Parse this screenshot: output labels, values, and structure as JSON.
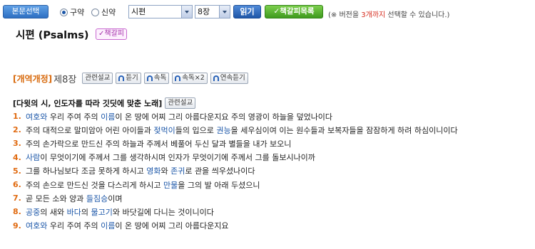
{
  "toolbar": {
    "select_label": "본문선택",
    "radio_old": "구약",
    "radio_new": "신약",
    "book_value": "시편",
    "chapter_value": "8장",
    "read_label": "읽기",
    "bookmark_list_label": "책갈피목록",
    "note_prefix": "(※ 버전을 ",
    "note_highlight": "3개까지",
    "note_suffix": " 선택할 수 있습니다.)"
  },
  "page": {
    "title": "시편 (Psalms)",
    "bookmark_badge": "책갈피"
  },
  "chapter": {
    "version": "[개역개정]",
    "chapter_label": "제8장",
    "buttons": [
      "관련설교",
      "듣기",
      "속독",
      "속독×2",
      "연속듣기"
    ]
  },
  "psalm_title": {
    "text": "[다윗의 시, 인도자를 따라 깃딧에 맞춘 노래]",
    "related_button": "관련설교"
  },
  "colors": {
    "verse_number": "#e06a10",
    "linked_word": "#1b56a8",
    "version_label": "#d86a0d",
    "note_highlight": "#d62a1c"
  },
  "verses": [
    {
      "num": "1.",
      "segments": [
        {
          "t": "여호와",
          "link": true
        },
        {
          "t": " 우리 주여 주의 "
        },
        {
          "t": "이름",
          "link": true
        },
        {
          "t": "이 온 땅에 어찌 그리 아름다운지요 주의 영광이 하늘을 덮었나이다"
        }
      ]
    },
    {
      "num": "2.",
      "segments": [
        {
          "t": "주의 대적으로 말미암아 어린 아이들과 "
        },
        {
          "t": "젖먹이",
          "link": true
        },
        {
          "t": "들의 입으로 "
        },
        {
          "t": "권능",
          "link": true
        },
        {
          "t": "을 세우심이여 이는 원수들과 보복자들을 잠잠하게 하려 하심이니이다"
        }
      ]
    },
    {
      "num": "3.",
      "segments": [
        {
          "t": "주의 손가락으로 만드신 주의 하늘과 주께서 베풀어 두신 달과 별들을 내가 보오니"
        }
      ]
    },
    {
      "num": "4.",
      "segments": [
        {
          "t": "사람",
          "link": true
        },
        {
          "t": "이 무엇이기에 주께서 그를 생각하시며 인자가 무엇이기에 주께서 그를 돌보시나이까"
        }
      ]
    },
    {
      "num": "5.",
      "segments": [
        {
          "t": "그를 하나님보다 조금 못하게 하시고 "
        },
        {
          "t": "영화",
          "link": true
        },
        {
          "t": "와 "
        },
        {
          "t": "존귀",
          "link": true
        },
        {
          "t": "로 관을 씌우셨나이다"
        }
      ]
    },
    {
      "num": "6.",
      "segments": [
        {
          "t": "주의 손으로 만드신 것을 다스리게 하시고 "
        },
        {
          "t": "만물",
          "link": true
        },
        {
          "t": "을 그의 발 아래 두셨으니"
        }
      ]
    },
    {
      "num": "7.",
      "segments": [
        {
          "t": "곧 모든 소와 양과 "
        },
        {
          "t": "들짐승",
          "link": true
        },
        {
          "t": "이며"
        }
      ]
    },
    {
      "num": "8.",
      "segments": [
        {
          "t": "공중",
          "link": true
        },
        {
          "t": "의 새와 "
        },
        {
          "t": "바다",
          "link": true
        },
        {
          "t": "의 "
        },
        {
          "t": "물고기",
          "link": true
        },
        {
          "t": "와 바닷길에 다니는 것이니이다"
        }
      ]
    },
    {
      "num": "9.",
      "segments": [
        {
          "t": "여호와",
          "link": true
        },
        {
          "t": " 우리 주여 주의 "
        },
        {
          "t": "이름",
          "link": true
        },
        {
          "t": "이 온 땅에 어찌 그리 아름다운지요"
        }
      ]
    }
  ]
}
